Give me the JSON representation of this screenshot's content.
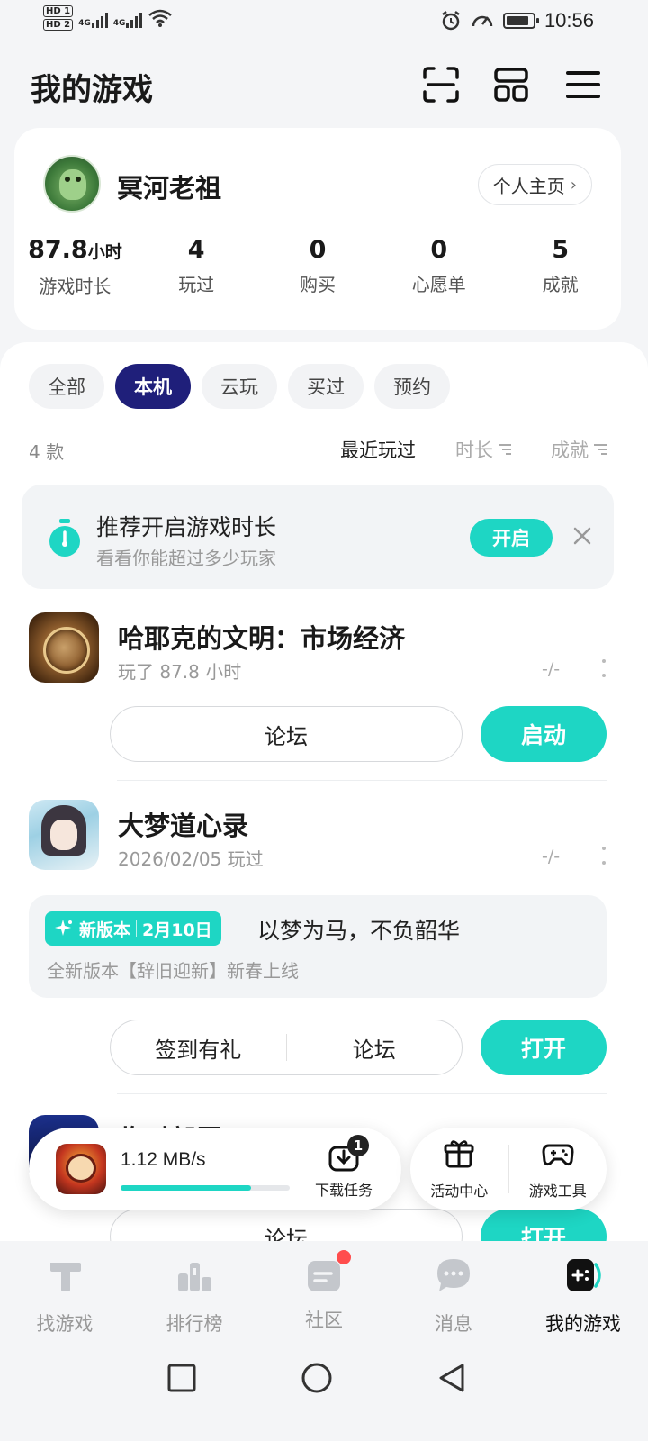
{
  "status_bar": {
    "hd1": "HD 1",
    "hd2": "HD 2",
    "net1": "4G",
    "net2": "4G",
    "time": "10:56",
    "battery_level": 0.85
  },
  "header": {
    "title": "我的游戏"
  },
  "profile": {
    "username": "冥河老祖",
    "home_button": "个人主页",
    "stats": [
      {
        "value": "87.8",
        "unit": "小时",
        "label": "游戏时长"
      },
      {
        "value": "4",
        "unit": "",
        "label": "玩过"
      },
      {
        "value": "0",
        "unit": "",
        "label": "购买"
      },
      {
        "value": "0",
        "unit": "",
        "label": "心愿单"
      },
      {
        "value": "5",
        "unit": "",
        "label": "成就"
      }
    ]
  },
  "filters": [
    "全部",
    "本机",
    "云玩",
    "买过",
    "预约"
  ],
  "active_filter": "本机",
  "count_label": "4 款",
  "sorts": [
    "最近玩过",
    "时长",
    "成就"
  ],
  "recommend": {
    "title": "推荐开启游戏时长",
    "subtitle": "看看你能超过多少玩家",
    "button": "开启"
  },
  "games": [
    {
      "title": "哈耶克的文明：市场经济",
      "subtitle": "玩了 87.8 小时",
      "dash": "-/-",
      "actions": [
        "论坛"
      ],
      "main_button": "启动"
    },
    {
      "title": "大梦道心录",
      "subtitle": "2026/02/05 玩过",
      "dash": "-/-",
      "news": {
        "tag": "新版本",
        "date": "2月10日",
        "title": "以梦为马，不负韶华",
        "subtitle": "全新版本【辞旧迎新】新春上线"
      },
      "actions": [
        "签到有礼",
        "论坛"
      ],
      "main_button": "打开"
    },
    {
      "title": "临时部署",
      "actions": [
        "论坛"
      ],
      "main_button": "打开"
    }
  ],
  "download": {
    "speed": "1.12 MB/s",
    "progress": 0.77,
    "task_label": "下载任务",
    "task_count": "1"
  },
  "tools": [
    {
      "label": "活动中心",
      "icon": "gift-icon"
    },
    {
      "label": "游戏工具",
      "icon": "gamepad-icon"
    }
  ],
  "bottom_nav": [
    {
      "label": "找游戏",
      "icon": "find-game-icon"
    },
    {
      "label": "排行榜",
      "icon": "ranking-icon"
    },
    {
      "label": "社区",
      "icon": "community-icon",
      "dot": true
    },
    {
      "label": "消息",
      "icon": "message-icon"
    },
    {
      "label": "我的游戏",
      "icon": "my-games-icon",
      "active": true
    }
  ],
  "colors": {
    "accent": "#1ed6c4",
    "active_chip": "#1f1f7a"
  }
}
